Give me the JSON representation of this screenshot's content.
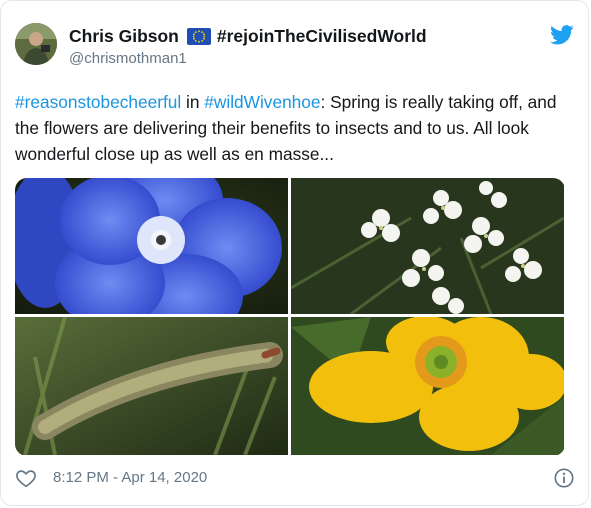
{
  "user": {
    "display_name": "Chris Gibson",
    "bio_tag": "#rejoinTheCivilisedWorld",
    "handle": "@chrismothman1"
  },
  "tweet": {
    "hashtag_1": "#reasonstobecheerful",
    "connector_1": " in ",
    "hashtag_2": "#wildWivenhoe",
    "body": ": Spring is really taking off, and the flowers are delivering their benefits to insects and to us. All look wonderful close up as well as en masse..."
  },
  "footer": {
    "timestamp": "8:12 PM - Apr 14, 2020"
  },
  "icons": {
    "brand": "twitter-bird-icon",
    "flag": "eu-flag-icon",
    "like": "heart-icon",
    "info": "info-icon"
  },
  "colors": {
    "link": "#1b95e0",
    "text": "#14171a",
    "muted": "#657786",
    "border": "#e1e8ed"
  }
}
